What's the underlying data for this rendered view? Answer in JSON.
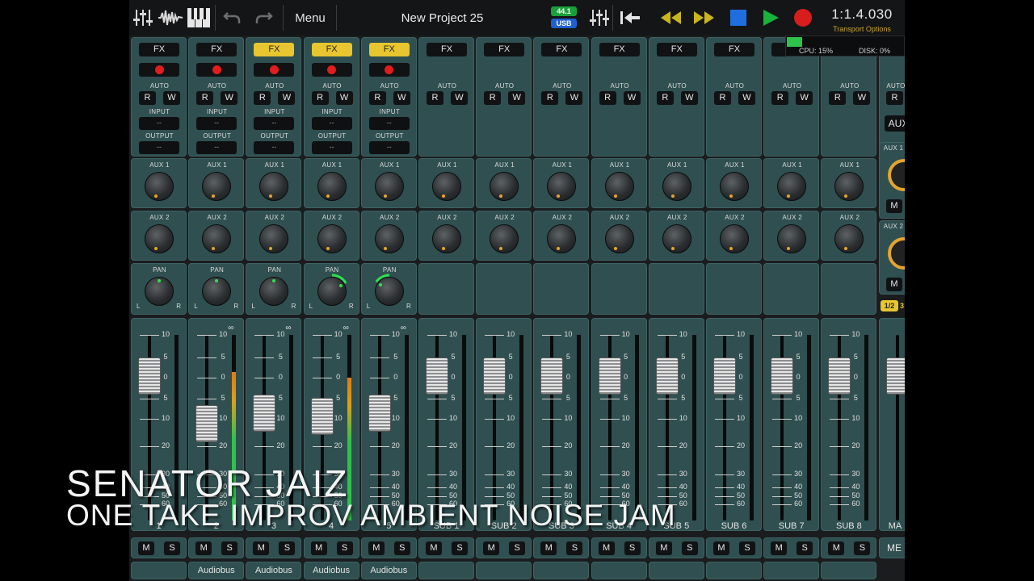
{
  "toolbar": {
    "menu_label": "Menu",
    "project_title": "New Project 25",
    "sample_rate": "44.1",
    "interface": "USB",
    "position": "1:1.4.030",
    "transport_options": "Transport Options",
    "icons": [
      "mixer-icon",
      "waveform-icon",
      "piano-icon",
      "undo-icon",
      "redo-icon",
      "fader-settings-icon",
      "return-to-start-icon",
      "rewind-icon",
      "fast-forward-icon",
      "stop-icon",
      "play-icon",
      "record-icon"
    ],
    "colors": {
      "rewind": "#c9b51c",
      "ffwd": "#c9b51c",
      "stop": "#1f6ee0",
      "play": "#17b33a",
      "record": "#d81d1d",
      "rate_bg": "#19a03a",
      "usb_bg": "#1f5fd0"
    }
  },
  "system": {
    "cpu": "CPU: 15%",
    "disk": "DISK: 0%",
    "cpu_level": 0.15,
    "disk_level": 0.0
  },
  "labels": {
    "fx": "FX",
    "auto": "AUTO",
    "read": "R",
    "write": "W",
    "input": "INPUT",
    "output": "OUTPUT",
    "io_value": "--",
    "aux1": "AUX 1",
    "aux2": "AUX 2",
    "pan": "PAN",
    "pan_left": "L",
    "pan_right": "R",
    "mute": "M",
    "solo": "S",
    "link": "∞"
  },
  "fader_scale": [
    "10",
    "5",
    "0",
    "5",
    "10",
    "20",
    "30",
    "40",
    "50",
    "60"
  ],
  "strips": [
    {
      "name": "1",
      "type": "track",
      "fx_on": false,
      "route": "",
      "fader": 0.78,
      "meter": 0.0,
      "pan": 0.5
    },
    {
      "name": "2",
      "type": "track",
      "fx_on": false,
      "route": "Audiobus",
      "fader": 0.52,
      "meter": 0.8,
      "pan": 0.5
    },
    {
      "name": "3",
      "type": "track",
      "fx_on": true,
      "route": "Audiobus",
      "fader": 0.58,
      "meter": 0.0,
      "pan": 0.5
    },
    {
      "name": "4",
      "type": "track",
      "fx_on": true,
      "route": "Audiobus",
      "fader": 0.56,
      "meter": 0.77,
      "pan": 0.72
    },
    {
      "name": "5",
      "type": "track",
      "fx_on": true,
      "route": "Audiobus",
      "fader": 0.58,
      "meter": 0.0,
      "pan": 0.3
    },
    {
      "name": "SUB 1",
      "type": "sub",
      "fx_on": false,
      "route": "",
      "fader": 0.78,
      "meter": 0.0,
      "pan": 0.5
    },
    {
      "name": "SUB 2",
      "type": "sub",
      "fx_on": false,
      "route": "",
      "fader": 0.78,
      "meter": 0.0,
      "pan": 0.5
    },
    {
      "name": "SUB 3",
      "type": "sub",
      "fx_on": false,
      "route": "",
      "fader": 0.78,
      "meter": 0.0,
      "pan": 0.5
    },
    {
      "name": "SUB 4",
      "type": "sub",
      "fx_on": false,
      "route": "",
      "fader": 0.78,
      "meter": 0.0,
      "pan": 0.5
    },
    {
      "name": "SUB 5",
      "type": "sub",
      "fx_on": false,
      "route": "",
      "fader": 0.78,
      "meter": 0.0,
      "pan": 0.5
    },
    {
      "name": "SUB 6",
      "type": "sub",
      "fx_on": false,
      "route": "",
      "fader": 0.78,
      "meter": 0.0,
      "pan": 0.5
    },
    {
      "name": "SUB 7",
      "type": "sub",
      "fx_on": false,
      "route": "",
      "fader": 0.78,
      "meter": 0.0,
      "pan": 0.5
    },
    {
      "name": "SUB 8",
      "type": "sub",
      "fx_on": false,
      "route": "",
      "fader": 0.78,
      "meter": 0.0,
      "pan": 0.5
    }
  ],
  "master": {
    "name": "MA",
    "aux_label": "AUX",
    "aux1": "AUX 1",
    "aux2": "AUX 2",
    "page": "1/2",
    "page_next": "3",
    "bottom": "ME",
    "mute": "M",
    "read": "R"
  },
  "overlay": {
    "artist": "SENATOR JAIZ",
    "title": "ONE TAKE IMPROV AMBIENT NOISE JAM"
  }
}
